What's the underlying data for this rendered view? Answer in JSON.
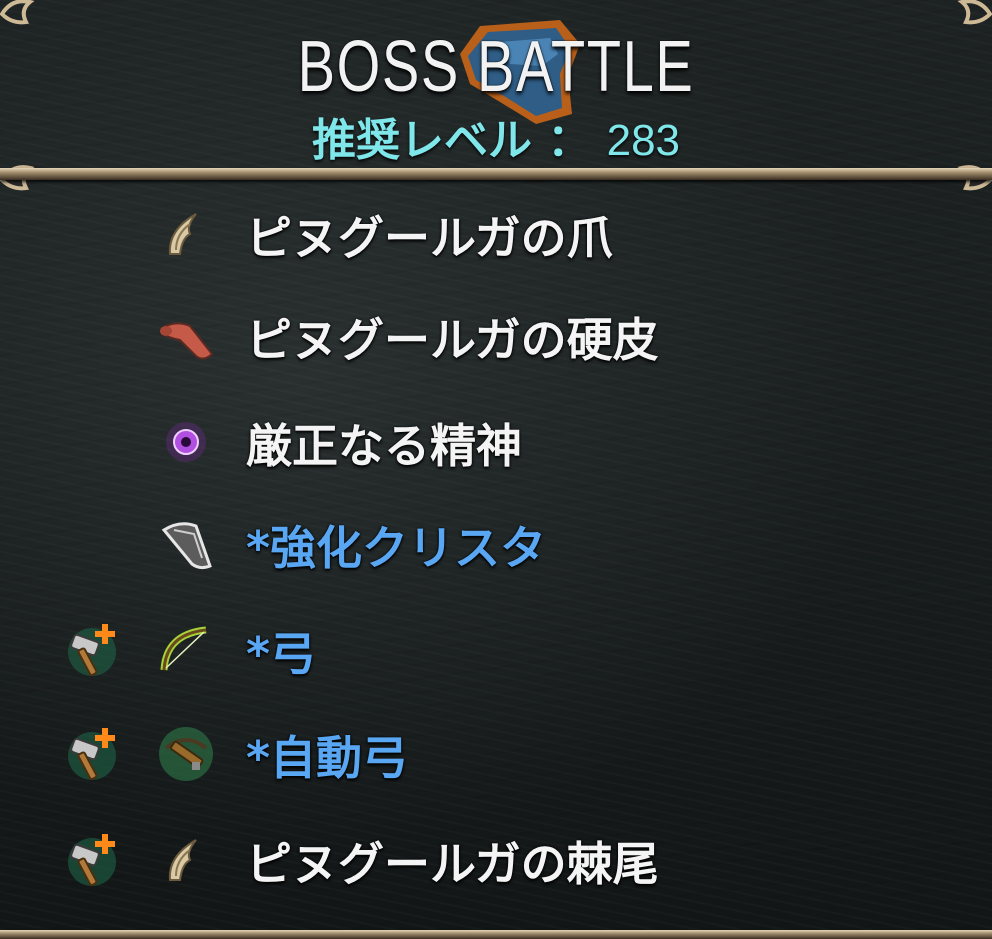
{
  "header": {
    "title": "BOSS BATTLE",
    "level_label": "推奨レベル ： ",
    "level_value": "283"
  },
  "colors": {
    "title": "#f2f2f2",
    "level": "#7fe6ea",
    "normal_item": "#f4f4f4",
    "highlight_item": "#59a6f3",
    "frame": "#cdb996"
  },
  "drops": [
    {
      "label": "ピヌグールガの爪",
      "icon": "claw-icon",
      "highlighted": false,
      "upgrade": false
    },
    {
      "label": "ピヌグールガの硬皮",
      "icon": "hide-icon",
      "highlighted": false,
      "upgrade": false
    },
    {
      "label": "厳正なる精神",
      "icon": "purple-orb-icon",
      "highlighted": false,
      "upgrade": false
    },
    {
      "label": "*強化クリスタ",
      "icon": "crystal-icon",
      "highlighted": true,
      "upgrade": false
    },
    {
      "label": "*弓",
      "icon": "bow-icon",
      "highlighted": true,
      "upgrade": true
    },
    {
      "label": "*自動弓",
      "icon": "crossbow-icon",
      "highlighted": true,
      "upgrade": true
    },
    {
      "label": "ピヌグールガの棘尾",
      "icon": "claw-icon",
      "highlighted": false,
      "upgrade": true
    }
  ],
  "upgrade_icon": "hammer-plus-icon"
}
